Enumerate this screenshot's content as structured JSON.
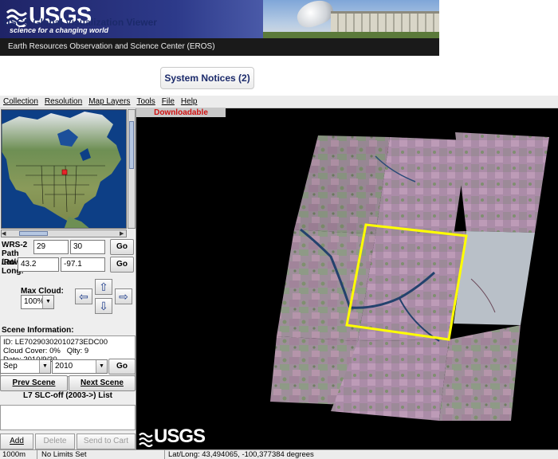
{
  "header": {
    "logo_text": "USGS",
    "tagline": "science for a changing world",
    "center_name": "Earth Resources Observation and Science Center (EROS)"
  },
  "app": {
    "title": "USGS Global Visualization Viewer",
    "notices_button": "System Notices (2)"
  },
  "menu": [
    "Collection",
    "Resolution",
    "Map Layers",
    "Tools",
    "File",
    "Help"
  ],
  "location": {
    "wrs_label": "WRS-2 Path /Row:",
    "path": "29",
    "row": "30",
    "latlong_label": "Lat/ Long:",
    "lat": "43.2",
    "long": "-97.1",
    "go_label": "Go"
  },
  "cloud": {
    "label": "Max Cloud:",
    "value": "100%"
  },
  "scene_info": {
    "heading": "Scene Information:",
    "id_line": "ID: LE70290302010273EDC00",
    "cloud_cover": "Cloud Cover: 0%",
    "quality": "Qlty: 9",
    "date_line": "Date: 2010/9/30"
  },
  "date_select": {
    "month": "Sep",
    "year": "2010",
    "go_label": "Go"
  },
  "nav": {
    "prev": "Prev Scene",
    "next": "Next Scene"
  },
  "list": {
    "title": "L7 SLC-off (2003->) List",
    "add": "Add",
    "delete": "Delete",
    "send": "Send to Cart"
  },
  "map": {
    "banner": "Downloadable",
    "watermark": "USGS"
  },
  "status": {
    "resolution": "1000m",
    "limits": "No Limits Set",
    "latlong": "Lat/Long:  43,494065, -100,377384 degrees"
  },
  "colors": {
    "usgs_blue": "#1b2a6b",
    "downloadable_red": "#d01010",
    "selection_yellow": "#ffff00"
  }
}
